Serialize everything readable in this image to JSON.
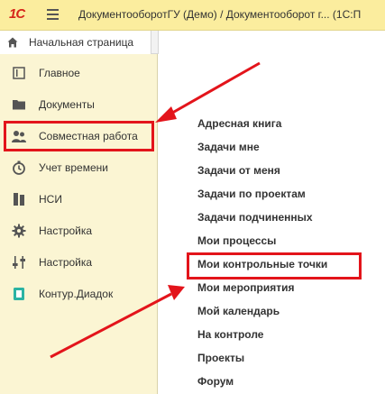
{
  "titlebar": {
    "logo": "1С",
    "title": "ДокументооборотГУ (Демо) / Документооборот г...  (1С:П"
  },
  "home_tab": {
    "label": "Начальная страница"
  },
  "sidebar": {
    "items": [
      {
        "label": "Главное",
        "icon": "list-icon"
      },
      {
        "label": "Документы",
        "icon": "folder-icon"
      },
      {
        "label": "Совместная работа",
        "icon": "people-icon"
      },
      {
        "label": "Учет времени",
        "icon": "clock-icon"
      },
      {
        "label": "НСИ",
        "icon": "books-icon"
      },
      {
        "label": "Настройка",
        "icon": "gear-icon"
      },
      {
        "label": "Настройка",
        "icon": "sliders-icon"
      },
      {
        "label": "Контур.Диадок",
        "icon": "diadoc-icon"
      }
    ]
  },
  "menu": {
    "items": [
      "Адресная книга",
      "Задачи мне",
      "Задачи от меня",
      "Задачи по проектам",
      "Задачи подчиненных",
      "Мои процессы",
      "Мои контрольные точки",
      "Мои мероприятия",
      "Мой календарь",
      "На контроле",
      "Проекты",
      "Форум"
    ]
  },
  "annotation": {
    "color": "#e3141b"
  },
  "colors": {
    "titlebar_bg": "#fbed9e",
    "sidebar_bg": "#fbf5d3"
  }
}
